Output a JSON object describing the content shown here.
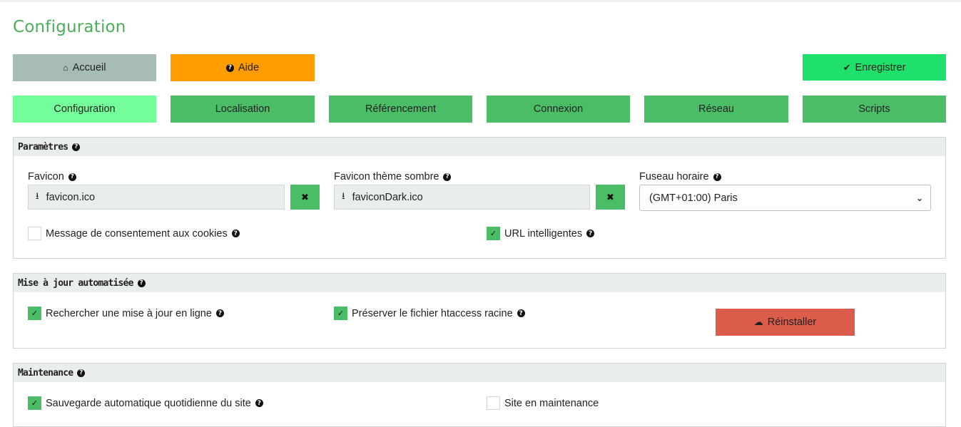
{
  "page": {
    "title": "Configuration"
  },
  "actions": {
    "home_label": "Accueil",
    "help_label": "Aide",
    "save_label": "Enregistrer"
  },
  "tabs": [
    {
      "label": "Configuration",
      "active": true
    },
    {
      "label": "Localisation"
    },
    {
      "label": "Référencement"
    },
    {
      "label": "Connexion"
    },
    {
      "label": "Réseau"
    },
    {
      "label": "Scripts"
    }
  ],
  "params": {
    "title": "Paramètres",
    "favicon_label": "Favicon",
    "favicon_value": "favicon.ico",
    "favicon_dark_label": "Favicon thème sombre",
    "favicon_dark_value": "faviconDark.ico",
    "timezone_label": "Fuseau horaire",
    "timezone_value": "(GMT+01:00) Paris",
    "cookie_label": "Message de consentement aux cookies",
    "cookie_checked": false,
    "smart_url_label": "URL intelligentes",
    "smart_url_checked": true
  },
  "update": {
    "title": "Mise à jour automatisée",
    "check_online_label": "Rechercher une mise à jour en ligne",
    "check_online_checked": true,
    "htaccess_label": "Préserver le fichier htaccess racine",
    "htaccess_checked": true,
    "reinstall_label": "Réinstaller"
  },
  "maintenance": {
    "title": "Maintenance",
    "backup_label": "Sauvegarde automatique quotidienne du site",
    "backup_checked": true,
    "maintenance_label": "Site en maintenance",
    "maintenance_checked": false
  },
  "colors": {
    "accent_green": "#4bbd66",
    "active_tab": "#75ff9a",
    "save_green": "#1fe06a",
    "help_orange": "#ff9c00",
    "home_gray": "#a7bcb3",
    "reinstall_red": "#dc5c4b",
    "title_green": "#4cae5b"
  }
}
